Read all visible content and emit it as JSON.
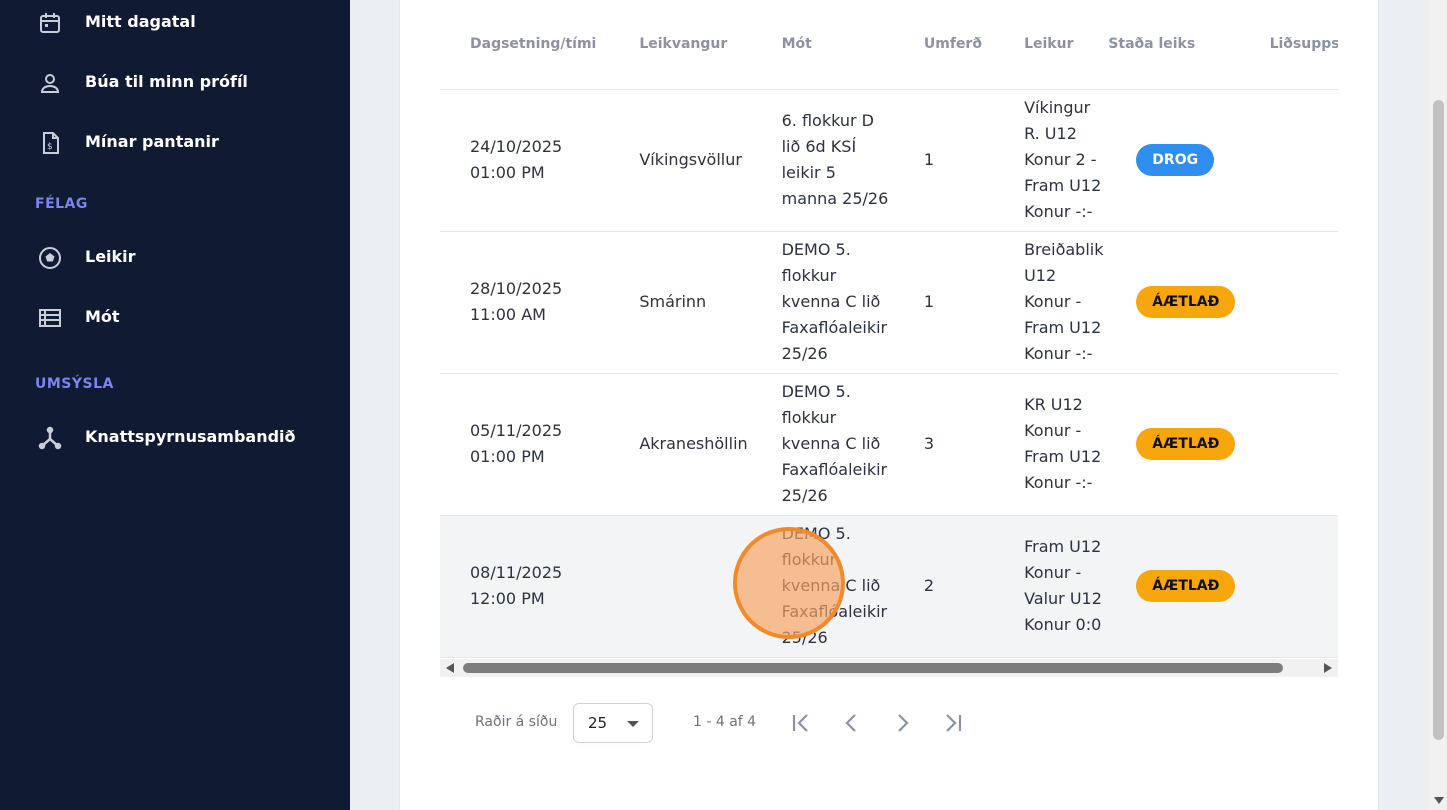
{
  "sidebar": {
    "items_top": [
      {
        "label": "Mitt dagatal",
        "icon": "calendar-icon"
      },
      {
        "label": "Búa til minn prófíl",
        "icon": "user-icon"
      },
      {
        "label": "Mínar pantanir",
        "icon": "invoice-icon"
      }
    ],
    "section_club": "FÉLAG",
    "items_club": [
      {
        "label": "Leikir",
        "icon": "soccer-ball-icon"
      },
      {
        "label": "Mót",
        "icon": "list-icon"
      }
    ],
    "section_admin": "UMSÝSLA",
    "items_admin": [
      {
        "label": "Knattspyrnusambandið",
        "icon": "network-icon"
      }
    ]
  },
  "table": {
    "columns": [
      "Dagsetning/tími",
      "Leikvangur",
      "Mót",
      "Umferð",
      "Leikur",
      "Staða leiks",
      "Liðsuppstilling"
    ],
    "rows": [
      {
        "date": "24/10/2025",
        "time": "01:00 PM",
        "venue": "Víkingsvöllur",
        "tournament": "6. flokkur D lið 6d KSÍ leikir 5 manna 25/26",
        "round": "1",
        "game": "Víkingur R. U12 Konur 2 - Fram U12 Konur -:-",
        "status": "DROG"
      },
      {
        "date": "28/10/2025",
        "time": "11:00 AM",
        "venue": "Smárinn",
        "tournament": "DEMO 5. flokkur kvenna C lið Faxaflóaleikir 25/26",
        "round": "1",
        "game": "Breiðablik U12 Konur - Fram U12 Konur -:-",
        "status": "ÁÆTLAÐ"
      },
      {
        "date": "05/11/2025",
        "time": "01:00 PM",
        "venue": "Akraneshöllin",
        "tournament": "DEMO 5. flokkur kvenna C lið Faxaflóaleikir 25/26",
        "round": "3",
        "game": "KR U12 Konur - Fram U12 Konur -:-",
        "status": "ÁÆTLAÐ"
      },
      {
        "date": "08/11/2025",
        "time": "12:00 PM",
        "venue": "",
        "tournament": "DEMO 5. flokkur kvenna C lið Faxaflóaleikir 25/26",
        "round": "2",
        "game": "Fram U12 Konur - Valur U12 Konur 0:0",
        "status": "ÁÆTLAÐ"
      }
    ]
  },
  "status_colors": {
    "DROG": "#2f8ff0",
    "ÁÆTLAÐ": "#f7a60c"
  },
  "pagination": {
    "rows_label": "Raðir á síðu",
    "rows_per_page": "25",
    "range": "1 - 4 af 4"
  }
}
